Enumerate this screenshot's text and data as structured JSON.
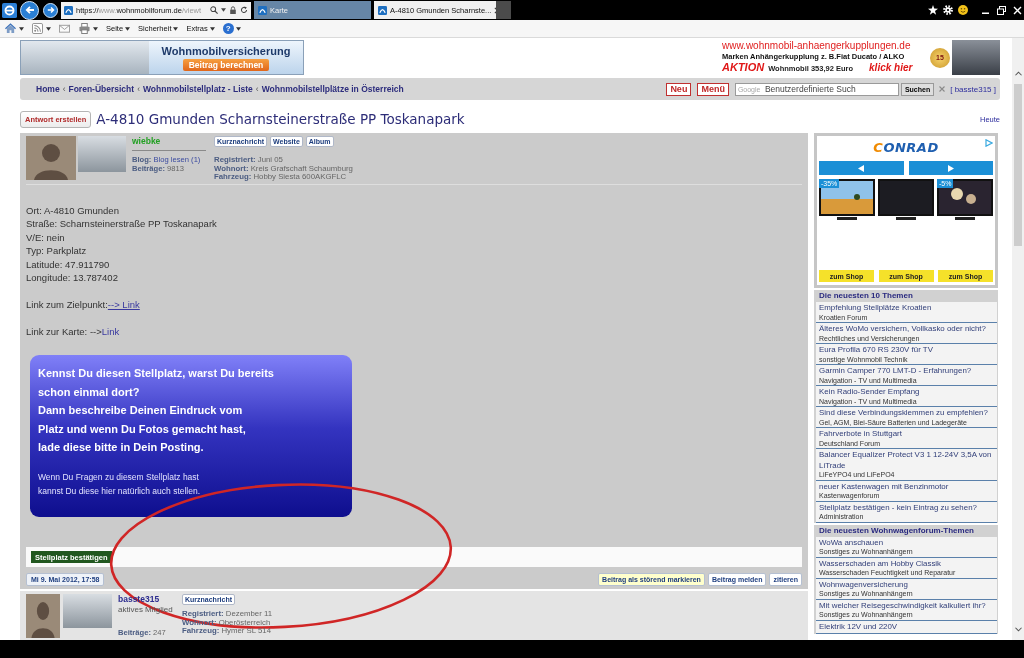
{
  "browser": {
    "address": {
      "scheme": "https://",
      "subdomain": "www.",
      "domain": "wohnmobilforum.de",
      "path": "/viewt"
    },
    "tabs": [
      {
        "title": "Karte",
        "selected": false
      },
      {
        "title": "A-4810 Gmunden Scharnste...",
        "selected": true
      }
    ],
    "command_menus": [
      "Seite",
      "Sicherheit",
      "Extras"
    ],
    "help_label": "?"
  },
  "banners": {
    "insurance": {
      "title": "Wohnmobilversicherung",
      "button": "Beitrag berechnen"
    },
    "hitch": {
      "url": "www.wohnmobil-anhaengerkupplungen.de",
      "subtitle": "Marken Anhängerkupplung z. B.Fiat Ducato / ALKO",
      "promo": "AKTION",
      "offer": "Wohnmobil 353,92 Euro",
      "cta": "klick hier",
      "badge": "15"
    }
  },
  "navbar": {
    "breadcrumb": [
      "Home",
      "Foren-Übersicht",
      "Wohnmobilstellplatz - Liste",
      "Wohnmobilstellplätze in Österreich"
    ],
    "separator": "‹",
    "buttons": [
      "Neu",
      "Menü"
    ],
    "search": {
      "brand": "Google",
      "placeholder": "Benutzerdefinierte Such",
      "button": "Suchen"
    },
    "user": "[ basste315 ]"
  },
  "topic": {
    "reply_button": "Antwort erstellen",
    "title": "A-4810 Gmunden Scharnsteinerstraße PP Toskanapark",
    "today": "Heute"
  },
  "posts": [
    {
      "author": "wiebke",
      "color": "#22a022",
      "blog": {
        "label": "Blog:",
        "link": "Blog lesen (1)"
      },
      "stats": [
        {
          "label": "Beiträge:",
          "value": "9813"
        }
      ],
      "buttons": [
        "Kurznachricht",
        "Website",
        "Album"
      ],
      "profile": [
        {
          "label": "Registriert:",
          "value": "Juni 05"
        },
        {
          "label": "Wohnort:",
          "value": "Kreis Grafschaft Schaumburg"
        },
        {
          "label": "Fahrzeug:",
          "value": "Hobby Siesta 600AKGFLC"
        }
      ],
      "details": [
        "Ort: A-4810 Gmunden",
        "Straße: Scharnsteinerstraße PP Toskanapark",
        "V/E: nein",
        "Typ: Parkplatz",
        "Latitude: 47.911790",
        "Longitude: 13.787402"
      ],
      "links": [
        {
          "label": "Link zum Zielpunkt:",
          "link": "--> Link",
          "underlined": true
        },
        {
          "label": "Link zur Karte: -->",
          "link": "Link",
          "underlined": false
        }
      ],
      "callout": {
        "heading_lines": [
          "Kennst Du diesen Stellplatz, warst Du bereits",
          "schon einmal dort?",
          "Dann beschreibe Deinen Eindruck vom",
          "Platz und wenn Du Fotos gemacht hast,",
          "lade diese bitte in Dein Posting."
        ],
        "note_lines": [
          "Wenn Du Fragen zu diesem Stellplatz hast",
          "kannst Du diese hier natürlich auch stellen."
        ]
      },
      "confirm_button": "Stellplatz bestätigen",
      "date": "Mi 9. Mai 2012, 17:58",
      "actions": [
        {
          "label": "Beitrag als störend markieren",
          "kind": "flag"
        },
        {
          "label": "Beitrag melden",
          "kind": "plain"
        },
        {
          "label": "zitieren",
          "kind": "plain"
        }
      ]
    },
    {
      "author": "basste315",
      "color": "#2d2d8f",
      "rank": "aktives Mitglied",
      "stats": [
        {
          "label": "Beiträge:",
          "value": "247"
        }
      ],
      "buttons": [
        "Kurznachricht"
      ],
      "profile": [
        {
          "label": "Registriert:",
          "value": "Dezember 11"
        },
        {
          "label": "Wohnort:",
          "value": "Oberösterreich"
        },
        {
          "label": "Fahrzeug:",
          "value": "Hymer SL 514"
        }
      ]
    }
  ],
  "sidebar": {
    "ad": {
      "brand": "CONRAD",
      "products": [
        {
          "kind": "landscape",
          "discount": "-35%",
          "button": "zum Shop"
        },
        {
          "kind": "dark",
          "button": "zum Shop"
        },
        {
          "kind": "stage",
          "discount": "-5%",
          "button": "zum Shop"
        }
      ]
    },
    "sections": [
      {
        "title": "Die neuesten 10 Themen",
        "items": [
          {
            "title": "Empfehlung Stellplätze Kroatien",
            "forum": "Kroatien Forum"
          },
          {
            "title": "Älteres WoMo versichern, Vollkasko oder nicht?",
            "forum": "Rechtliches und Versicherungen"
          },
          {
            "title": "Eura Profila 670 RS 230V für TV",
            "forum": "sonstige Wohnmobil Technik"
          },
          {
            "title": "Garmin Camper 770 LMT-D - Erfahrungen?",
            "forum": "Navigation - TV und Multimedia"
          },
          {
            "title": "Kein Radio-Sender Empfang",
            "forum": "Navigation - TV und Multimedia"
          },
          {
            "title": "Sind diese Verbindungsklemmen zu empfehlen?",
            "forum": "Gel, AGM, Blei-Säure Batterien und Ladegeräte"
          },
          {
            "title": "Fahrverbote in Stuttgart",
            "forum": "Deutschland Forum"
          },
          {
            "title": "Balancer Equalizer Protect V3 1 12-24V 3,5A von LiTrade",
            "forum": "LiFeYPO4 und LiFePO4"
          },
          {
            "title": "neuer Kastenwagen mit Benzinmotor",
            "forum": "Kastenwagenforum"
          },
          {
            "title": "Stellplatz bestätigen - kein Eintrag zu sehen?",
            "forum": "Administration"
          }
        ]
      },
      {
        "title": "Die neuesten Wohnwagenforum-Themen",
        "items": [
          {
            "title": "WoWa anschauen",
            "forum": "Sonstiges zu Wohnanhängern"
          },
          {
            "title": "Wasserschaden am Hobby Classik",
            "forum": "Wasserschaden Feuchtigkeit und Reparatur"
          },
          {
            "title": "Wohnwagenversicherung",
            "forum": "Sonstiges zu Wohnanhängern"
          },
          {
            "title": "Mit welcher Reisegeschwindigkeit kalkuliert ihr?",
            "forum": "Sonstiges zu Wohnanhängern"
          },
          {
            "title": "Elektrik 12V und 220V"
          }
        ]
      }
    ]
  }
}
